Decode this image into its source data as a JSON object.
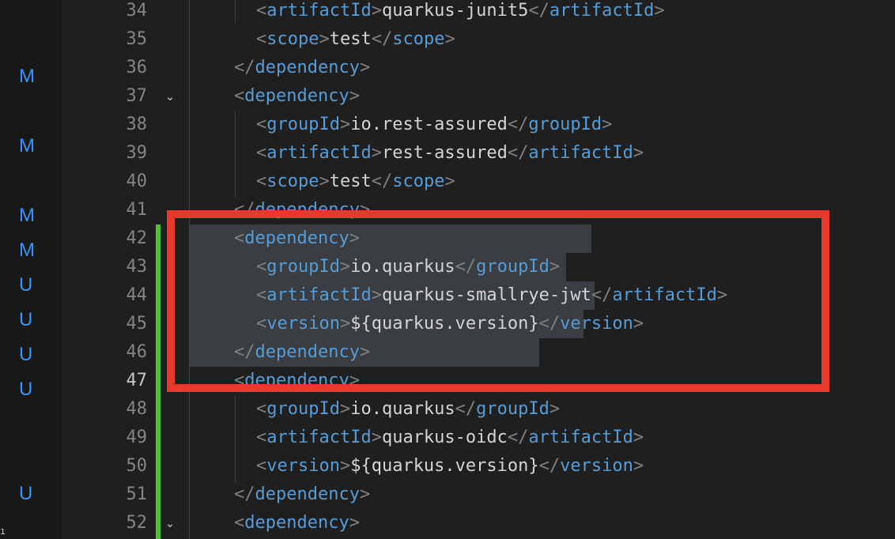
{
  "scm_decorations": [
    "M",
    "M",
    "M",
    "M",
    "U",
    "U",
    "U",
    "U",
    "U"
  ],
  "colors": {
    "tag": "#569cd6",
    "punctuation": "#808080",
    "text": "#d4d4d4",
    "added_bar": "#4ec12f",
    "highlight_box": "#e8392a",
    "selection": "#3a3d41",
    "scm_letter": "#3794ff"
  },
  "lines": [
    {
      "num": "34",
      "tag": "artifactId",
      "value": "quarkus-junit5"
    },
    {
      "num": "35",
      "tag": "scope",
      "value": "test"
    },
    {
      "num": "36",
      "tag": "dependency"
    },
    {
      "num": "37",
      "tag": "dependency"
    },
    {
      "num": "38",
      "tag": "groupId",
      "value": "io.rest-assured"
    },
    {
      "num": "39",
      "tag": "artifactId",
      "value": "rest-assured"
    },
    {
      "num": "40",
      "tag": "scope",
      "value": "test"
    },
    {
      "num": "41",
      "tag": "dependency"
    },
    {
      "num": "42",
      "tag": "dependency"
    },
    {
      "num": "43",
      "tag": "groupId",
      "value": "io.quarkus"
    },
    {
      "num": "44",
      "tag": "artifactId",
      "value": "quarkus-smallrye-jwt"
    },
    {
      "num": "45",
      "tag": "version",
      "value": "${quarkus.version}"
    },
    {
      "num": "46",
      "tag": "dependency"
    },
    {
      "num": "47",
      "tag": "dependency"
    },
    {
      "num": "48",
      "tag": "groupId",
      "value": "io.quarkus"
    },
    {
      "num": "49",
      "tag": "artifactId",
      "value": "quarkus-oidc"
    },
    {
      "num": "50",
      "tag": "version",
      "value": "${quarkus.version}"
    },
    {
      "num": "51",
      "tag": "dependency"
    },
    {
      "num": "52",
      "tag": "dependency"
    }
  ],
  "punct": {
    "open": "<",
    "close": ">",
    "end_open": "</"
  }
}
